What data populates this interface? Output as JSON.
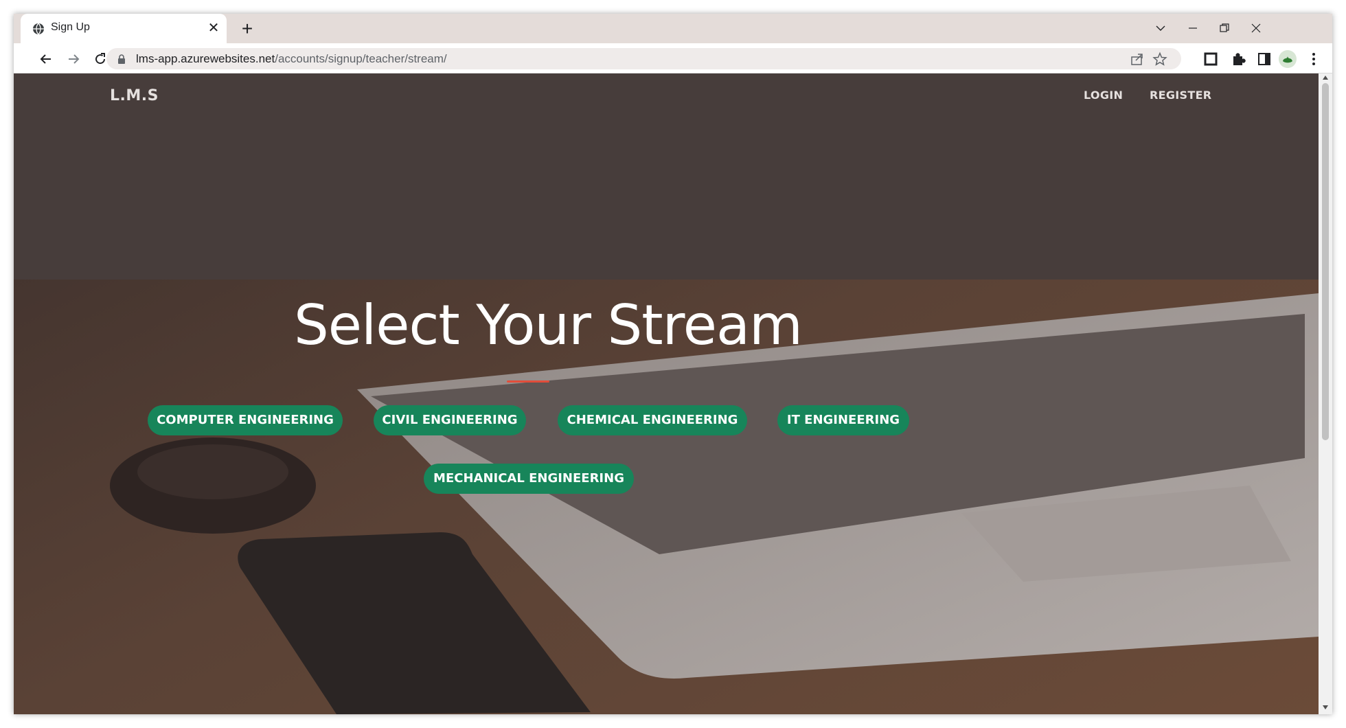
{
  "browser": {
    "tab_title": "Sign Up",
    "new_tab_label": "+",
    "close_tab_label": "✕",
    "url_host": "lms-app.azurewebsites.net",
    "url_path": "/accounts/signup/teacher/stream/",
    "icons": {
      "tab_favicon": "globe-icon",
      "back": "arrow-left-icon",
      "forward": "arrow-right-icon",
      "reload": "reload-icon",
      "secure": "lock-icon",
      "share": "share-icon",
      "bookmark": "star-icon",
      "extension_1": "square-extension-icon",
      "extensions": "puzzle-icon",
      "side_panel": "side-panel-icon",
      "profile": "avatar-icon",
      "menu": "kebab-menu-icon",
      "tab_search": "chevron-down-icon",
      "minimize": "minimize-icon",
      "restore": "restore-icon",
      "close": "close-icon"
    }
  },
  "page": {
    "brand": "L.M.S",
    "nav": {
      "login": "LOGIN",
      "register": "REGISTER"
    },
    "headline": "Select Your Stream",
    "streams": [
      "COMPUTER ENGINEERING",
      "CIVIL ENGINEERING",
      "CHEMICAL ENGINEERING",
      "IT ENGINEERING",
      "MECHANICAL ENGINEERING"
    ],
    "colors": {
      "button_bg": "#17855a",
      "divider": "#e24d3a",
      "overlay": "#4a3f3b"
    }
  }
}
